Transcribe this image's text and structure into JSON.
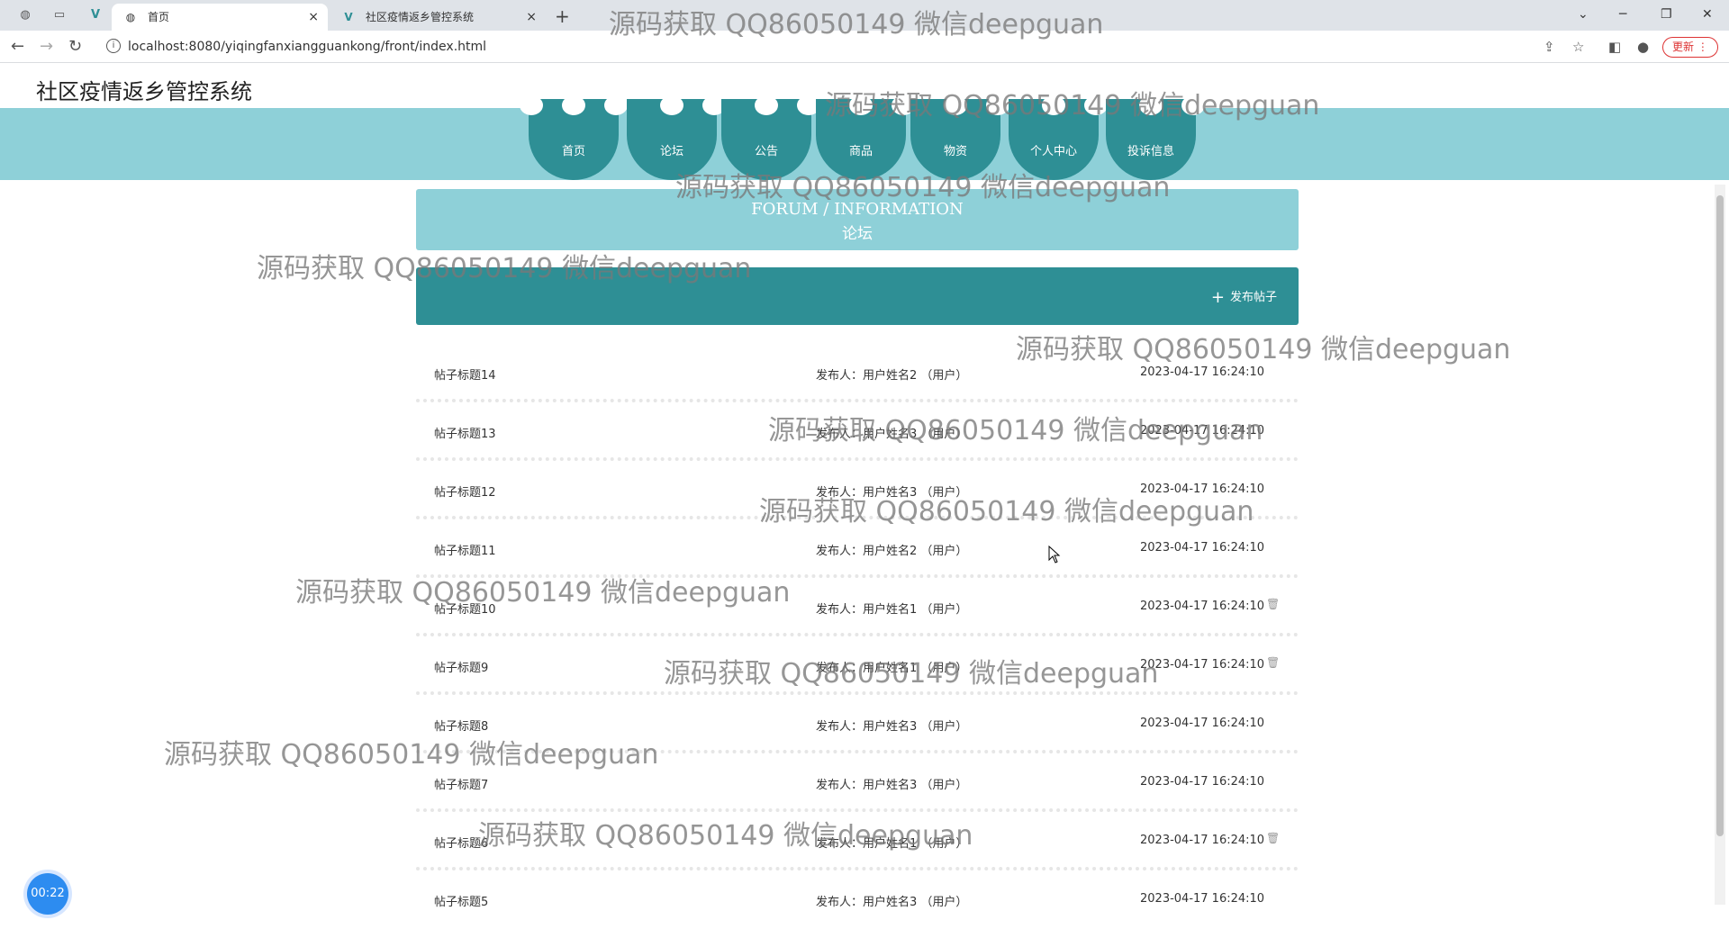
{
  "browser": {
    "tabs": [
      {
        "label": "首页",
        "active": true
      },
      {
        "label": "社区疫情返乡管控系统",
        "active": false
      }
    ],
    "url": "localhost:8080/yiqingfanxiangguankong/front/index.html",
    "update_label": "更新"
  },
  "site": {
    "title": "社区疫情返乡管控系统",
    "nav": [
      "首页",
      "论坛",
      "公告",
      "商品",
      "物资",
      "个人中心",
      "投诉信息"
    ]
  },
  "banner": {
    "en": "FORUM / INFORMATION",
    "zh": "论坛"
  },
  "actions": {
    "post_label": "发布帖子"
  },
  "posts": [
    {
      "title": "帖子标题14",
      "author": "发布人：用户姓名2 （用户）",
      "date": "2023-04-17 16:24:10",
      "deletable": false
    },
    {
      "title": "帖子标题13",
      "author": "发布人：用户姓名3 （用户）",
      "date": "2023-04-17 16:24:10",
      "deletable": false
    },
    {
      "title": "帖子标题12",
      "author": "发布人：用户姓名3 （用户）",
      "date": "2023-04-17 16:24:10",
      "deletable": false
    },
    {
      "title": "帖子标题11",
      "author": "发布人：用户姓名2 （用户）",
      "date": "2023-04-17 16:24:10",
      "deletable": false
    },
    {
      "title": "帖子标题10",
      "author": "发布人：用户姓名1 （用户）",
      "date": "2023-04-17 16:24:10",
      "deletable": true
    },
    {
      "title": "帖子标题9",
      "author": "发布人：用户姓名1 （用户）",
      "date": "2023-04-17 16:24:10",
      "deletable": true
    },
    {
      "title": "帖子标题8",
      "author": "发布人：用户姓名3 （用户）",
      "date": "2023-04-17 16:24:10",
      "deletable": false
    },
    {
      "title": "帖子标题7",
      "author": "发布人：用户姓名3 （用户）",
      "date": "2023-04-17 16:24:10",
      "deletable": false
    },
    {
      "title": "帖子标题6",
      "author": "发布人：用户姓名1 （用户）",
      "date": "2023-04-17 16:24:10",
      "deletable": true
    },
    {
      "title": "帖子标题5",
      "author": "发布人：用户姓名3 （用户）",
      "date": "2023-04-17 16:24:10",
      "deletable": false
    }
  ],
  "timer": "00:22",
  "watermark": "源码获取 QQ86050149 微信deepguan",
  "icons": {
    "delete": "trash-icon",
    "plus": "plus-icon"
  },
  "colors": {
    "nav_band": "#8ed0d8",
    "nav_bubble": "#2e8f95",
    "timer": "#2d8cf0"
  }
}
